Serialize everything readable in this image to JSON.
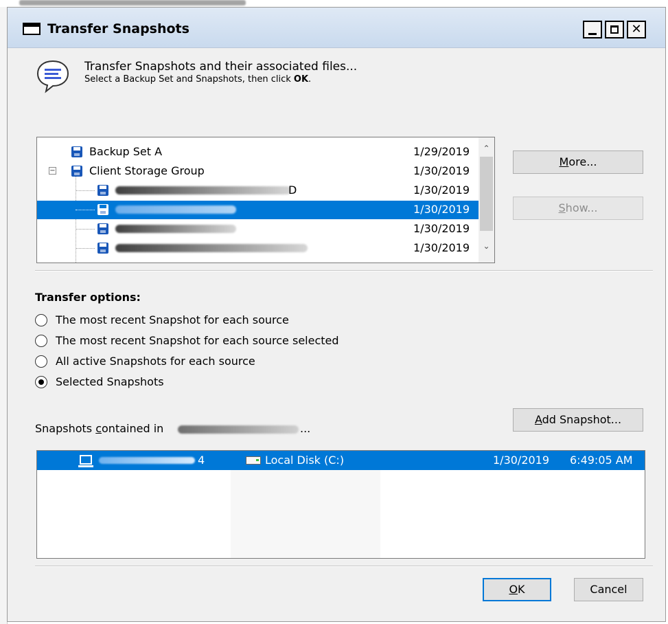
{
  "window": {
    "title": "Transfer Snapshots",
    "min_glyph": "_",
    "close_glyph": "✕"
  },
  "header": {
    "main_text": "Transfer Snapshots and their associated files...",
    "sub_text_prefix": "Select a Backup Set and Snapshots, then click ",
    "sub_text_bold": "OK",
    "sub_text_suffix": "."
  },
  "tree": {
    "expander_glyph": "−",
    "rows": [
      {
        "label": "Backup Set A",
        "date": "1/29/2019"
      },
      {
        "label": "Client Storage Group",
        "date": "1/30/2019"
      },
      {
        "label": "",
        "tail": "D",
        "date": "1/30/2019"
      },
      {
        "label": "",
        "date": "1/30/2019",
        "selected": true
      },
      {
        "label": "",
        "date": "1/30/2019"
      },
      {
        "label": "",
        "date": "1/30/2019"
      }
    ],
    "scroll_up_glyph": "⌃",
    "scroll_down_glyph": "⌄"
  },
  "buttons": {
    "more_underlined": "M",
    "more_rest": "ore...",
    "show_underlined": "S",
    "show_rest": "how...",
    "add_snapshot_underlined": "A",
    "add_snapshot_rest": "dd Snapshot...",
    "ok_underlined": "O",
    "ok_rest": "K",
    "cancel": "Cancel"
  },
  "transfer_options": {
    "title": "Transfer options:",
    "options": [
      {
        "label": "The most recent Snapshot for each source",
        "selected": false
      },
      {
        "label": "The most recent Snapshot for each source selected",
        "selected": false
      },
      {
        "label": "All active Snapshots for each source",
        "selected": false
      },
      {
        "label": "Selected Snapshots",
        "selected": true
      }
    ]
  },
  "contained": {
    "label_prefix": "Snapshots ",
    "label_underlined": "c",
    "label_suffix": "ontained in",
    "ellipsis": "..."
  },
  "snapshot_list": {
    "rows": [
      {
        "name_tail": "4",
        "disk": "Local Disk (C:)",
        "date": "1/30/2019",
        "time": "6:49:05 AM",
        "selected": true
      }
    ]
  },
  "colors": {
    "selection": "#0078d7",
    "dialog_bg": "#f0f0f0",
    "titlebar": "#c9daee"
  }
}
